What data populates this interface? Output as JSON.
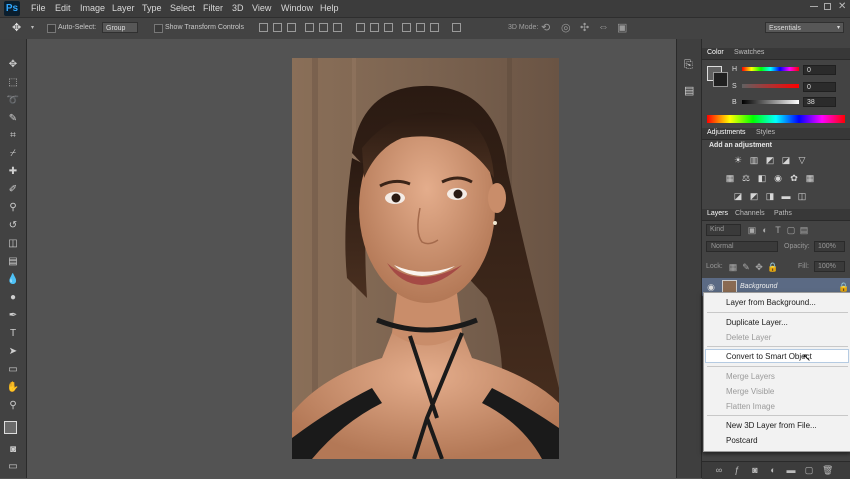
{
  "app": {
    "logo": "Ps"
  },
  "menu": [
    "File",
    "Edit",
    "Image",
    "Layer",
    "Type",
    "Select",
    "Filter",
    "3D",
    "View",
    "Window",
    "Help"
  ],
  "options": {
    "auto_select_label": "Auto-Select:",
    "auto_select_value": "Group",
    "show_transform_label": "Show Transform Controls",
    "mode_3d_label": "3D Mode:",
    "workspace": "Essentials"
  },
  "color_panel": {
    "tabs": [
      "Color",
      "Swatches"
    ],
    "h_label": "H",
    "h_value": "0",
    "s_label": "S",
    "s_value": "0",
    "b_label": "B",
    "b_value": "38"
  },
  "adjustments_panel": {
    "tabs": [
      "Adjustments",
      "Styles"
    ],
    "heading": "Add an adjustment"
  },
  "layers_panel": {
    "tabs": [
      "Layers",
      "Channels",
      "Paths"
    ],
    "kind_label": "Kind",
    "blend_mode": "Normal",
    "opacity_label": "Opacity:",
    "opacity_value": "100%",
    "lock_label": "Lock:",
    "fill_label": "Fill:",
    "fill_value": "100%",
    "layer_name": "Background"
  },
  "context_menu": {
    "layer_from_background": "Layer from Background...",
    "duplicate_layer": "Duplicate Layer...",
    "delete_layer": "Delete Layer",
    "convert_smart_object": "Convert to Smart Object",
    "merge_layers": "Merge Layers",
    "merge_visible": "Merge Visible",
    "flatten_image": "Flatten Image",
    "new_3d_layer": "New 3D Layer from File...",
    "postcard": "Postcard"
  },
  "colors": {
    "menubar_bg": "#3c3c3c",
    "workspace_bg": "#535353",
    "panel_bg": "#434343",
    "menu_bg": "#f2f2f2",
    "brand": "#31a8ff"
  }
}
